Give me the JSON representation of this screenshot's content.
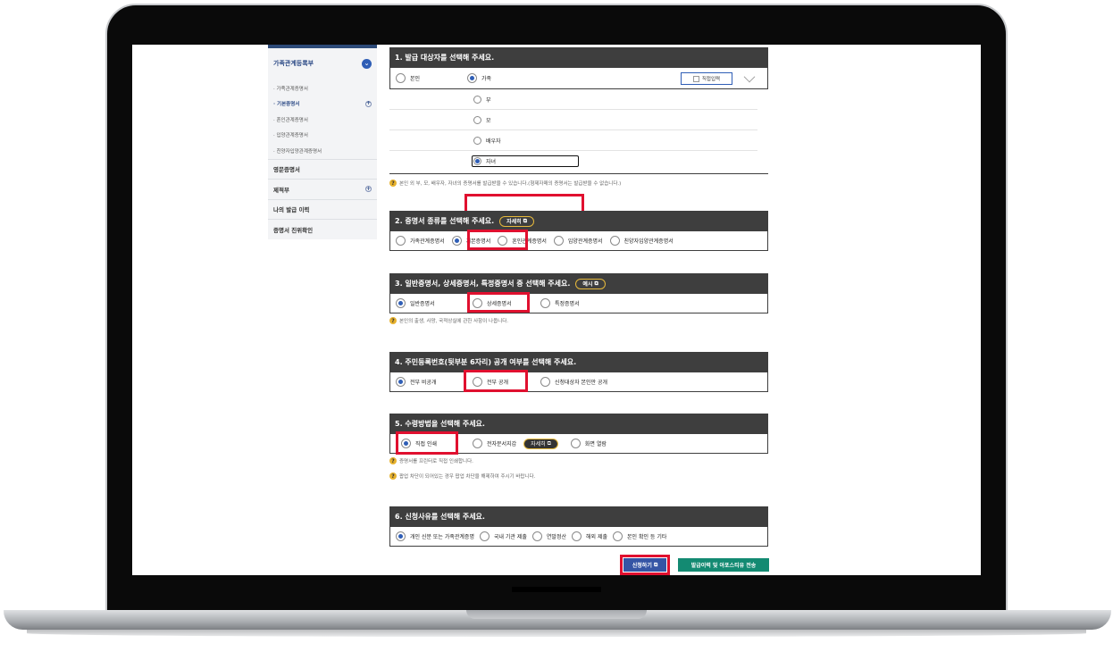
{
  "sidebar": {
    "header": "가족관계등록부",
    "sub_items": [
      "가족관계증명서",
      "기본증명서",
      "혼인관계증명서",
      "입양관계증명서",
      "친양자입양관계증명서"
    ],
    "items": [
      "영문증명서",
      "제적부",
      "나의 발급 이력",
      "증명서 진위확인"
    ]
  },
  "s1": {
    "title": "1. 발급 대상자를 선택해 주세요.",
    "opt_self": "본인",
    "opt_family": "가족",
    "direct_input": "직접입력",
    "family": [
      "부",
      "모",
      "배우자",
      "자녀"
    ],
    "note": "본인 외 부, 모, 배우자, 자녀의 증명서를 발급받을 수 있습니다.(형제자매의 증명서는 발급받을 수 없습니다.)"
  },
  "s2": {
    "title": "2. 증명서 종류를 선택해 주세요.",
    "detail": "자세히",
    "options": [
      "가족관계증명서",
      "기본증명서",
      "혼인관계증명서",
      "입양관계증명서",
      "친양자입양관계증명서"
    ]
  },
  "s3": {
    "title": "3. 일반증명서, 상세증명서, 특정증명서 중 선택해 주세요.",
    "example": "예시",
    "options": [
      "일반증명서",
      "상세증명서",
      "특정증명서"
    ],
    "note": "본인의 출생, 사망, 국적상실에 관한 사항이 나옵니다."
  },
  "s4": {
    "title": "4. 주민등록번호(뒷부분 6자리) 공개 여부를 선택해 주세요.",
    "options": [
      "전부 비공개",
      "전부 공개",
      "신청대상자 본인만 공개"
    ]
  },
  "s5": {
    "title": "5. 수령방법을 선택해 주세요.",
    "options": [
      "직접 인쇄",
      "전자문서지갑",
      "화면 열람"
    ],
    "detail": "자세히",
    "note1": "증명서를 프린터로 직접 인쇄합니다.",
    "note2": "팝업 차단이 되어있는 경우 팝업 차단을 해제하여 주시기 바랍니다."
  },
  "s6": {
    "title": "6. 신청사유를 선택해 주세요.",
    "options": [
      "개인 신분 또는 가족관계증명",
      "국내 기관 제출",
      "연말정산",
      "해외 제출",
      "본인 확인 등 기타"
    ]
  },
  "buttons": {
    "apply": "신청하기",
    "apostille": "발급이력 및 아포스티유 전송"
  },
  "colors": {
    "highlight": "#e0102f",
    "header": "#3e3e3e",
    "selected": "#2f5eb6",
    "accent_green": "#138a72"
  }
}
